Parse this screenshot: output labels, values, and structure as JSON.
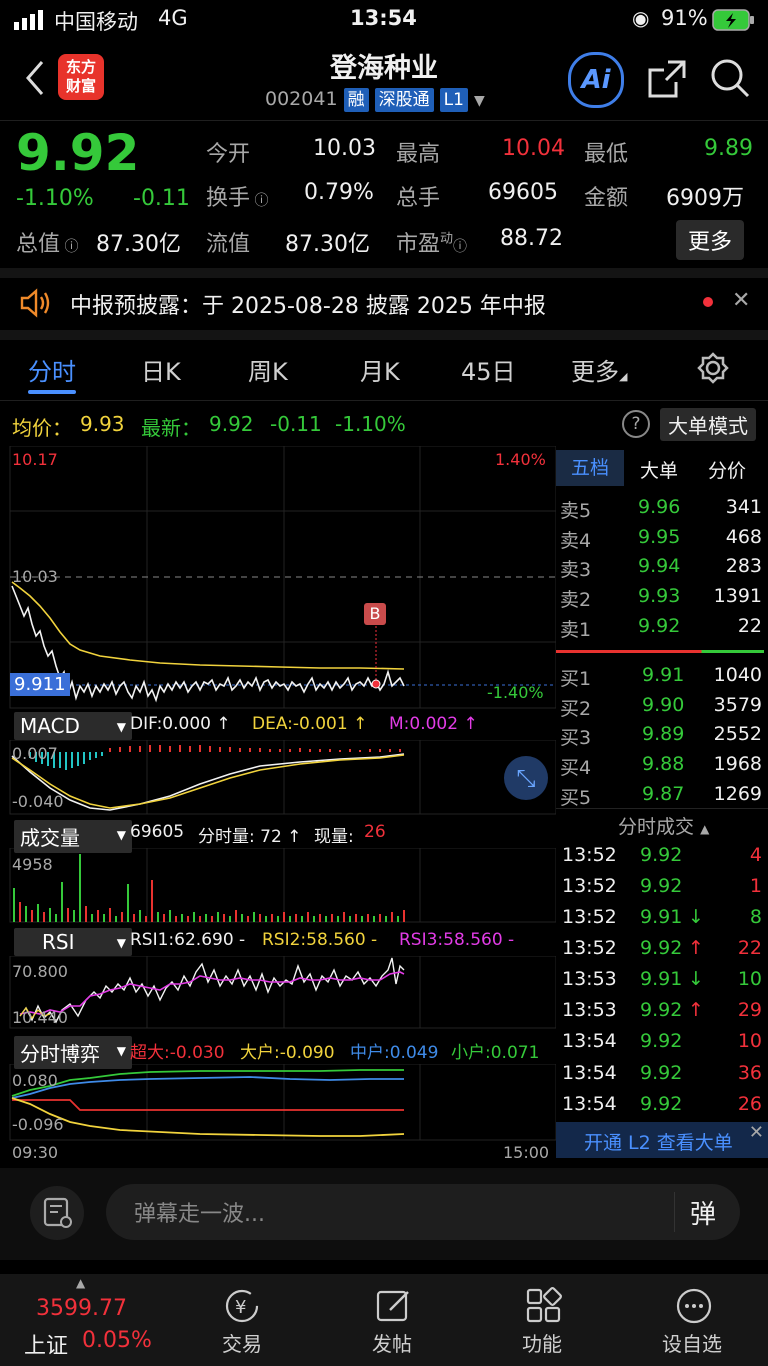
{
  "status_bar": {
    "carrier": "中国移动",
    "network": "4G",
    "time": "13:54",
    "battery": "91%"
  },
  "header": {
    "title": "登海种业",
    "code": "002041",
    "badges": [
      "融",
      "深股通",
      "L1"
    ],
    "logo_text_1": "东方",
    "logo_text_2": "财富",
    "ai_label": "Ai"
  },
  "quote": {
    "price": "9.92",
    "change_pct": "-1.10%",
    "change": "-0.11",
    "open_label": "今开",
    "open": "10.03",
    "high_label": "最高",
    "high": "10.04",
    "low_label": "最低",
    "low": "9.89",
    "turnover_label": "换手",
    "turnover": "0.79%",
    "volume_label": "总手",
    "volume": "69605",
    "amount_label": "金额",
    "amount": "6909万",
    "mktcap_label": "总值",
    "mktcap": "87.30亿",
    "float_label": "流值",
    "float_cap": "87.30亿",
    "pe_label": "市盈",
    "pe_sup": "动",
    "pe": "88.72",
    "more_label": "更多"
  },
  "notice": {
    "text": "中报预披露：于 2025-08-28 披露 2025 年中报"
  },
  "tabs": [
    "分时",
    "日K",
    "周K",
    "月K",
    "45日",
    "更多"
  ],
  "intraday": {
    "avg_label": "均价：",
    "avg": "9.93",
    "latest_label": "最新：",
    "latest": "9.92",
    "chg": "-0.11",
    "chg_pct": "-1.10%",
    "mode_label": "大单模式",
    "high_axis": "10.17",
    "high_pct": "1.40%",
    "ref_price": "10.03",
    "cur_price": "9.911",
    "low_pct": "-1.40%",
    "b_marker": "B",
    "time_start": "09:30",
    "time_end": "15:00"
  },
  "macd": {
    "label": "MACD",
    "dif": "DIF:0.000 ↑",
    "dea": "DEA:-0.001 ↑",
    "m": "M:0.002 ↑",
    "top": "0.007",
    "bottom": "-0.040"
  },
  "volume_panel": {
    "label": "成交量",
    "total": "69605",
    "min_vol": "分时量: 72 ↑",
    "cur_label": "现量:",
    "cur": "26",
    "axis": "4958"
  },
  "rsi": {
    "label": "RSI",
    "rsi1": "RSI1:62.690 -",
    "rsi2": "RSI2:58.560 -",
    "rsi3": "RSI3:58.560 -",
    "top": "70.800",
    "bottom": "10.440"
  },
  "game": {
    "label": "分时博弈",
    "super": "超大:-0.030",
    "large": "大户:-0.090",
    "mid": "中户:0.049",
    "small": "小户:0.071",
    "top": "0.080",
    "bottom": "-0.096"
  },
  "orderbook": {
    "tabs": [
      "五档",
      "大单",
      "分价"
    ],
    "sells": [
      [
        "卖5",
        "9.96",
        "341"
      ],
      [
        "卖4",
        "9.95",
        "468"
      ],
      [
        "卖3",
        "9.94",
        "283"
      ],
      [
        "卖2",
        "9.93",
        "1391"
      ],
      [
        "卖1",
        "9.92",
        "22"
      ]
    ],
    "buys": [
      [
        "买1",
        "9.91",
        "1040"
      ],
      [
        "买2",
        "9.90",
        "3579"
      ],
      [
        "买3",
        "9.89",
        "2552"
      ],
      [
        "买4",
        "9.88",
        "1968"
      ],
      [
        "买5",
        "9.87",
        "1269"
      ]
    ]
  },
  "trades": {
    "title": "分时成交",
    "rows": [
      [
        "13:52",
        "9.92",
        "",
        "4"
      ],
      [
        "13:52",
        "9.92",
        "",
        "1"
      ],
      [
        "13:52",
        "9.91",
        "↓",
        "8"
      ],
      [
        "13:52",
        "9.92",
        "↑",
        "22"
      ],
      [
        "13:53",
        "9.91",
        "↓",
        "10"
      ],
      [
        "13:53",
        "9.92",
        "↑",
        "29"
      ],
      [
        "13:54",
        "9.92",
        "",
        "10"
      ],
      [
        "13:54",
        "9.92",
        "",
        "36"
      ],
      [
        "13:54",
        "9.92",
        "",
        "26"
      ]
    ],
    "l2_banner": "开通 L2 查看大单"
  },
  "comment": {
    "placeholder": "弹幕走一波...",
    "danmu": "弹"
  },
  "bottom_nav": {
    "index_value": "3599.77",
    "index_name": "上证",
    "index_pct": "0.05%",
    "items": [
      "交易",
      "发帖",
      "功能",
      "设自选"
    ]
  },
  "chart_data": {
    "type": "line",
    "title": "",
    "x_range": [
      "09:30",
      "15:00"
    ],
    "y_range": [
      9.89,
      10.17
    ],
    "ref_price": 10.03,
    "series": []
  }
}
